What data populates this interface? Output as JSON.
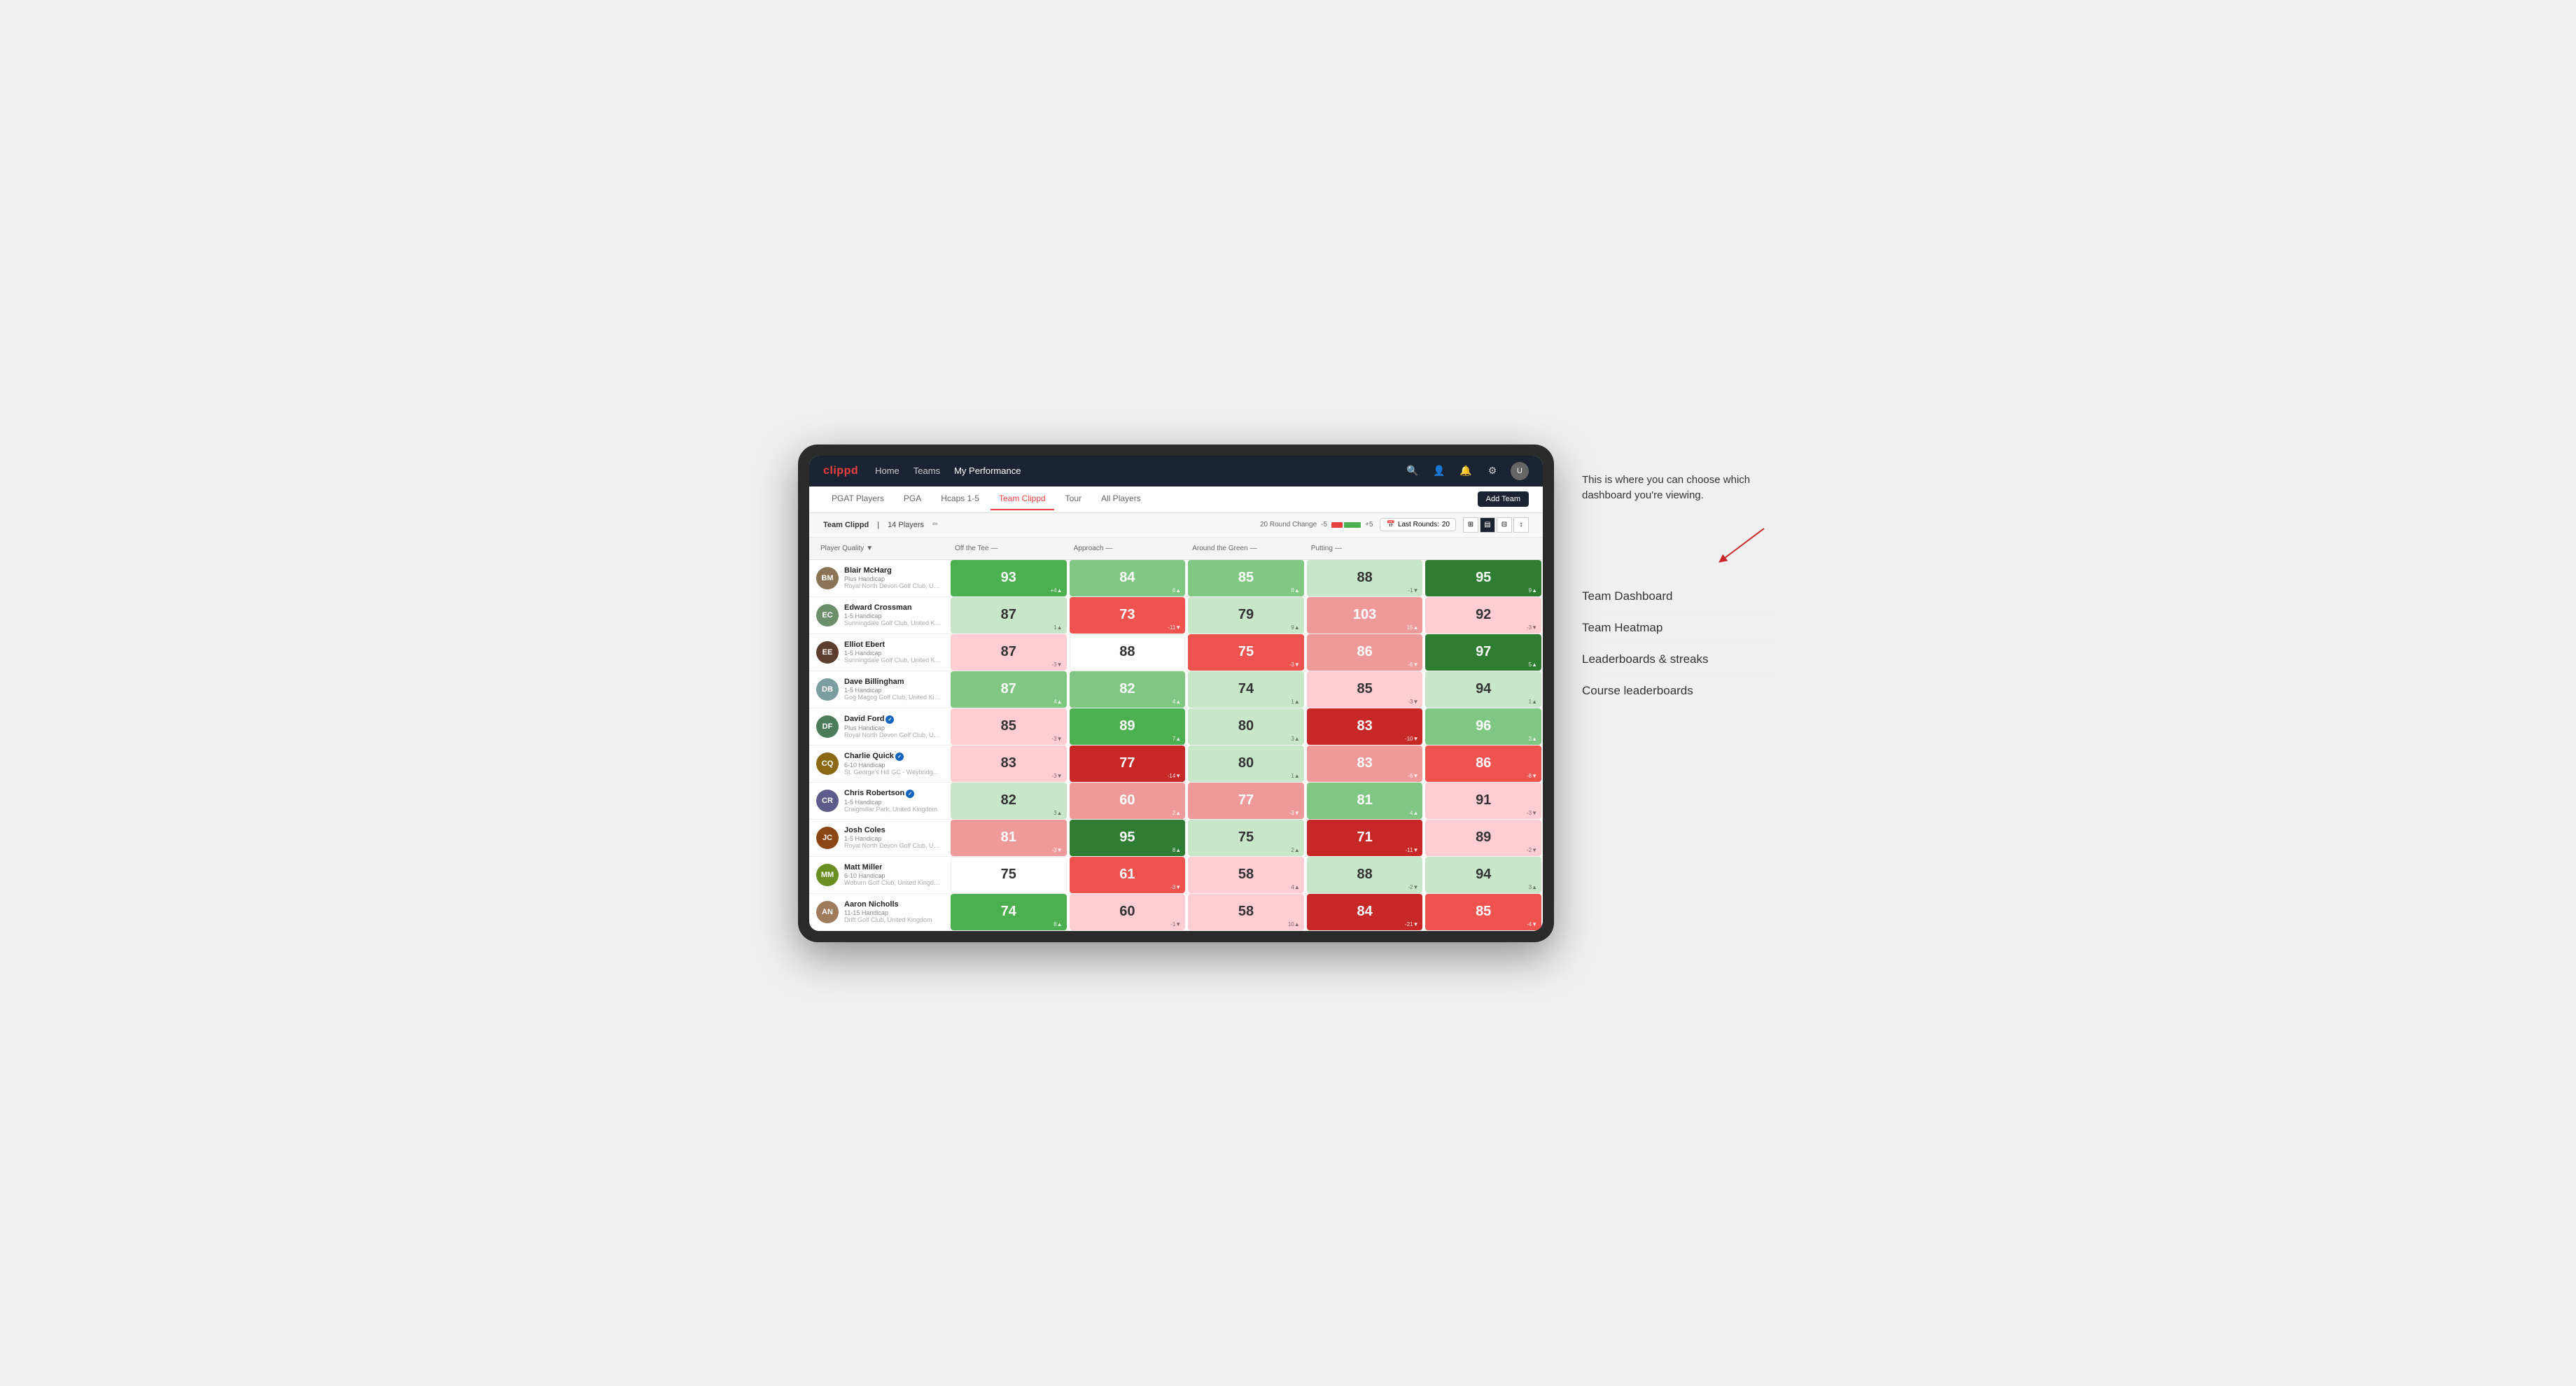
{
  "annotation": {
    "description": "This is where you can choose which dashboard you're viewing.",
    "arrow_direction": "right-down",
    "menu_title": "Team Dashboard",
    "menu_items": [
      "Team Dashboard",
      "Team Heatmap",
      "Leaderboards & streaks",
      "Course leaderboards"
    ]
  },
  "nav": {
    "logo": "clippd",
    "links": [
      "Home",
      "Teams",
      "My Performance"
    ],
    "active_link": "My Performance"
  },
  "tabs": {
    "items": [
      "PGAT Players",
      "PGA",
      "Hcaps 1-5",
      "Team Clippd",
      "Tour",
      "All Players"
    ],
    "active": "Team Clippd",
    "add_button": "Add Team"
  },
  "sub_header": {
    "team_name": "Team Clippd",
    "player_count": "14 Players",
    "round_change_label": "20 Round Change",
    "neg_value": "-5",
    "pos_value": "+5",
    "last_rounds_label": "Last Rounds:",
    "last_rounds_value": "20"
  },
  "columns": {
    "player": "Player Quality",
    "off_tee": "Off the Tee",
    "approach": "Approach",
    "around_green": "Around the Green",
    "putting": "Putting"
  },
  "players": [
    {
      "name": "Blair McHarg",
      "handicap": "Plus Handicap",
      "club": "Royal North Devon Golf Club, United Kingdom",
      "avatar_color": "#8B7355",
      "initials": "BM",
      "scores": {
        "quality": {
          "value": 93,
          "change": "+4",
          "dir": "up",
          "bg": "bg-green-med"
        },
        "off_tee": {
          "value": 84,
          "change": "6",
          "dir": "up",
          "bg": "bg-green-light"
        },
        "approach": {
          "value": 85,
          "change": "8",
          "dir": "up",
          "bg": "bg-green-light"
        },
        "around_green": {
          "value": 88,
          "change": "-1",
          "dir": "down",
          "bg": "bg-green-pale"
        },
        "putting": {
          "value": 95,
          "change": "9",
          "dir": "up",
          "bg": "bg-green-strong"
        }
      }
    },
    {
      "name": "Edward Crossman",
      "handicap": "1-5 Handicap",
      "club": "Sunningdale Golf Club, United Kingdom",
      "avatar_color": "#6B8E6B",
      "initials": "EC",
      "scores": {
        "quality": {
          "value": 87,
          "change": "1",
          "dir": "up",
          "bg": "bg-green-pale"
        },
        "off_tee": {
          "value": 73,
          "change": "-11",
          "dir": "down",
          "bg": "bg-red-med"
        },
        "approach": {
          "value": 79,
          "change": "9",
          "dir": "up",
          "bg": "bg-green-pale"
        },
        "around_green": {
          "value": 103,
          "change": "15",
          "dir": "up",
          "bg": "bg-red-light"
        },
        "putting": {
          "value": 92,
          "change": "-3",
          "dir": "down",
          "bg": "bg-red-pale"
        }
      }
    },
    {
      "name": "Elliot Ebert",
      "handicap": "1-5 Handicap",
      "club": "Sunningdale Golf Club, United Kingdom",
      "avatar_color": "#5C3D2E",
      "initials": "EE",
      "scores": {
        "quality": {
          "value": 87,
          "change": "-3",
          "dir": "down",
          "bg": "bg-red-pale"
        },
        "off_tee": {
          "value": 88,
          "change": "",
          "dir": "",
          "bg": "bg-white"
        },
        "approach": {
          "value": 75,
          "change": "-3",
          "dir": "down",
          "bg": "bg-red-med"
        },
        "around_green": {
          "value": 86,
          "change": "-6",
          "dir": "down",
          "bg": "bg-red-light"
        },
        "putting": {
          "value": 97,
          "change": "5",
          "dir": "up",
          "bg": "bg-green-strong"
        }
      }
    },
    {
      "name": "Dave Billingham",
      "handicap": "1-5 Handicap",
      "club": "Gog Magog Golf Club, United Kingdom",
      "avatar_color": "#7A9E9F",
      "initials": "DB",
      "scores": {
        "quality": {
          "value": 87,
          "change": "4",
          "dir": "up",
          "bg": "bg-green-light"
        },
        "off_tee": {
          "value": 82,
          "change": "4",
          "dir": "up",
          "bg": "bg-green-light"
        },
        "approach": {
          "value": 74,
          "change": "1",
          "dir": "up",
          "bg": "bg-green-pale"
        },
        "around_green": {
          "value": 85,
          "change": "-3",
          "dir": "down",
          "bg": "bg-red-pale"
        },
        "putting": {
          "value": 94,
          "change": "1",
          "dir": "up",
          "bg": "bg-green-pale"
        }
      }
    },
    {
      "name": "David Ford",
      "handicap": "Plus Handicap",
      "club": "Royal North Devon Golf Club, United Kingdom",
      "avatar_color": "#4A7C59",
      "initials": "DF",
      "verified": true,
      "scores": {
        "quality": {
          "value": 85,
          "change": "-3",
          "dir": "down",
          "bg": "bg-red-pale"
        },
        "off_tee": {
          "value": 89,
          "change": "7",
          "dir": "up",
          "bg": "bg-green-med"
        },
        "approach": {
          "value": 80,
          "change": "3",
          "dir": "up",
          "bg": "bg-green-pale"
        },
        "around_green": {
          "value": 83,
          "change": "-10",
          "dir": "down",
          "bg": "bg-red-strong"
        },
        "putting": {
          "value": 96,
          "change": "3",
          "dir": "up",
          "bg": "bg-green-light"
        }
      }
    },
    {
      "name": "Charlie Quick",
      "handicap": "6-10 Handicap",
      "club": "St. George's Hill GC - Weybridge - Surrey, Uni...",
      "avatar_color": "#8B6914",
      "initials": "CQ",
      "verified": true,
      "scores": {
        "quality": {
          "value": 83,
          "change": "-3",
          "dir": "down",
          "bg": "bg-red-pale"
        },
        "off_tee": {
          "value": 77,
          "change": "-14",
          "dir": "down",
          "bg": "bg-red-strong"
        },
        "approach": {
          "value": 80,
          "change": "1",
          "dir": "up",
          "bg": "bg-green-pale"
        },
        "around_green": {
          "value": 83,
          "change": "-6",
          "dir": "down",
          "bg": "bg-red-light"
        },
        "putting": {
          "value": 86,
          "change": "-8",
          "dir": "down",
          "bg": "bg-red-med"
        }
      }
    },
    {
      "name": "Chris Robertson",
      "handicap": "1-5 Handicap",
      "club": "Craigmillar Park, United Kingdom",
      "avatar_color": "#5C5C8A",
      "initials": "CR",
      "verified": true,
      "scores": {
        "quality": {
          "value": 82,
          "change": "3",
          "dir": "up",
          "bg": "bg-green-pale"
        },
        "off_tee": {
          "value": 60,
          "change": "2",
          "dir": "up",
          "bg": "bg-red-light"
        },
        "approach": {
          "value": 77,
          "change": "-3",
          "dir": "down",
          "bg": "bg-red-light"
        },
        "around_green": {
          "value": 81,
          "change": "4",
          "dir": "up",
          "bg": "bg-green-light"
        },
        "putting": {
          "value": 91,
          "change": "-3",
          "dir": "down",
          "bg": "bg-red-pale"
        }
      }
    },
    {
      "name": "Josh Coles",
      "handicap": "1-5 Handicap",
      "club": "Royal North Devon Golf Club, United Kingdom",
      "avatar_color": "#8B4513",
      "initials": "JC",
      "scores": {
        "quality": {
          "value": 81,
          "change": "-3",
          "dir": "down",
          "bg": "bg-red-light"
        },
        "off_tee": {
          "value": 95,
          "change": "8",
          "dir": "up",
          "bg": "bg-green-strong"
        },
        "approach": {
          "value": 75,
          "change": "2",
          "dir": "up",
          "bg": "bg-green-pale"
        },
        "around_green": {
          "value": 71,
          "change": "-11",
          "dir": "down",
          "bg": "bg-red-strong"
        },
        "putting": {
          "value": 89,
          "change": "-2",
          "dir": "down",
          "bg": "bg-red-pale"
        }
      }
    },
    {
      "name": "Matt Miller",
      "handicap": "6-10 Handicap",
      "club": "Woburn Golf Club, United Kingdom",
      "avatar_color": "#6B8E23",
      "initials": "MM",
      "scores": {
        "quality": {
          "value": 75,
          "change": "",
          "dir": "",
          "bg": "bg-white"
        },
        "off_tee": {
          "value": 61,
          "change": "-3",
          "dir": "down",
          "bg": "bg-red-med"
        },
        "approach": {
          "value": 58,
          "change": "4",
          "dir": "up",
          "bg": "bg-red-pale"
        },
        "around_green": {
          "value": 88,
          "change": "-2",
          "dir": "down",
          "bg": "bg-green-pale"
        },
        "putting": {
          "value": 94,
          "change": "3",
          "dir": "up",
          "bg": "bg-green-pale"
        }
      }
    },
    {
      "name": "Aaron Nicholls",
      "handicap": "11-15 Handicap",
      "club": "Drift Golf Club, United Kingdom",
      "avatar_color": "#9E7B5A",
      "initials": "AN",
      "scores": {
        "quality": {
          "value": 74,
          "change": "8",
          "dir": "up",
          "bg": "bg-green-med"
        },
        "off_tee": {
          "value": 60,
          "change": "-1",
          "dir": "down",
          "bg": "bg-red-pale"
        },
        "approach": {
          "value": 58,
          "change": "10",
          "dir": "up",
          "bg": "bg-red-pale"
        },
        "around_green": {
          "value": 84,
          "change": "-21",
          "dir": "down",
          "bg": "bg-red-strong"
        },
        "putting": {
          "value": 85,
          "change": "-4",
          "dir": "down",
          "bg": "bg-red-med"
        }
      }
    }
  ]
}
